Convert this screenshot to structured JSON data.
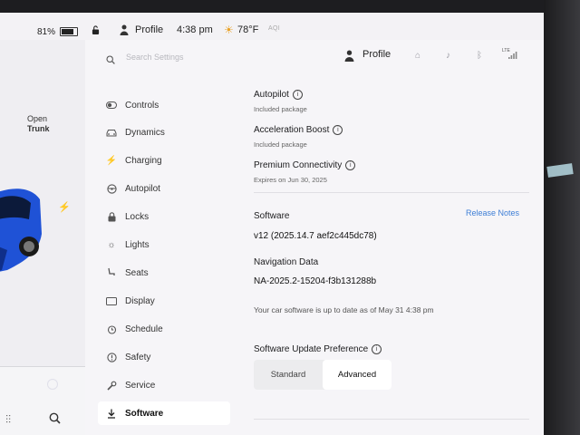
{
  "status_bar": {
    "battery": "81%",
    "battery_level": 0.81,
    "profile": "Profile",
    "time": "4:38 pm",
    "temperature": "78°F",
    "aqi": "AQI"
  },
  "left_panel": {
    "open_trunk_line1": "Open",
    "open_trunk_line2": "Trunk",
    "car_color": "#1e4fd8"
  },
  "header": {
    "search_placeholder": "Search Settings",
    "profile": "Profile",
    "lte": "LTE"
  },
  "menu": {
    "items": [
      {
        "label": "Controls",
        "icon": "toggle-icon"
      },
      {
        "label": "Dynamics",
        "icon": "car-icon"
      },
      {
        "label": "Charging",
        "icon": "bolt-icon"
      },
      {
        "label": "Autopilot",
        "icon": "steering-wheel-icon"
      },
      {
        "label": "Locks",
        "icon": "lock-icon"
      },
      {
        "label": "Lights",
        "icon": "sun-icon"
      },
      {
        "label": "Seats",
        "icon": "seat-icon"
      },
      {
        "label": "Display",
        "icon": "display-icon"
      },
      {
        "label": "Schedule",
        "icon": "alarm-clock-icon"
      },
      {
        "label": "Safety",
        "icon": "warning-icon"
      },
      {
        "label": "Service",
        "icon": "wrench-icon"
      },
      {
        "label": "Software",
        "icon": "download-icon"
      }
    ],
    "active": "Software"
  },
  "content": {
    "autopilot_title": "Autopilot",
    "autopilot_sub": "Included package",
    "accel_title": "Acceleration Boost",
    "accel_sub": "Included package",
    "premium_title": "Premium Connectivity",
    "premium_sub": "Expires on Jun 30, 2025",
    "software_title": "Software",
    "release_notes": "Release Notes",
    "software_version": "v12 (2025.14.7 aef2c445dc78)",
    "nav_title": "Navigation Data",
    "nav_version": "NA-2025.2-15204-f3b131288b",
    "uptodate": "Your car software is up to date as of May 31 4:38 pm",
    "update_pref_title": "Software Update Preference",
    "pref_standard": "Standard",
    "pref_advanced": "Advanced",
    "pref_selected": "Advanced"
  },
  "colors": {
    "accent": "#3f7fd6"
  }
}
